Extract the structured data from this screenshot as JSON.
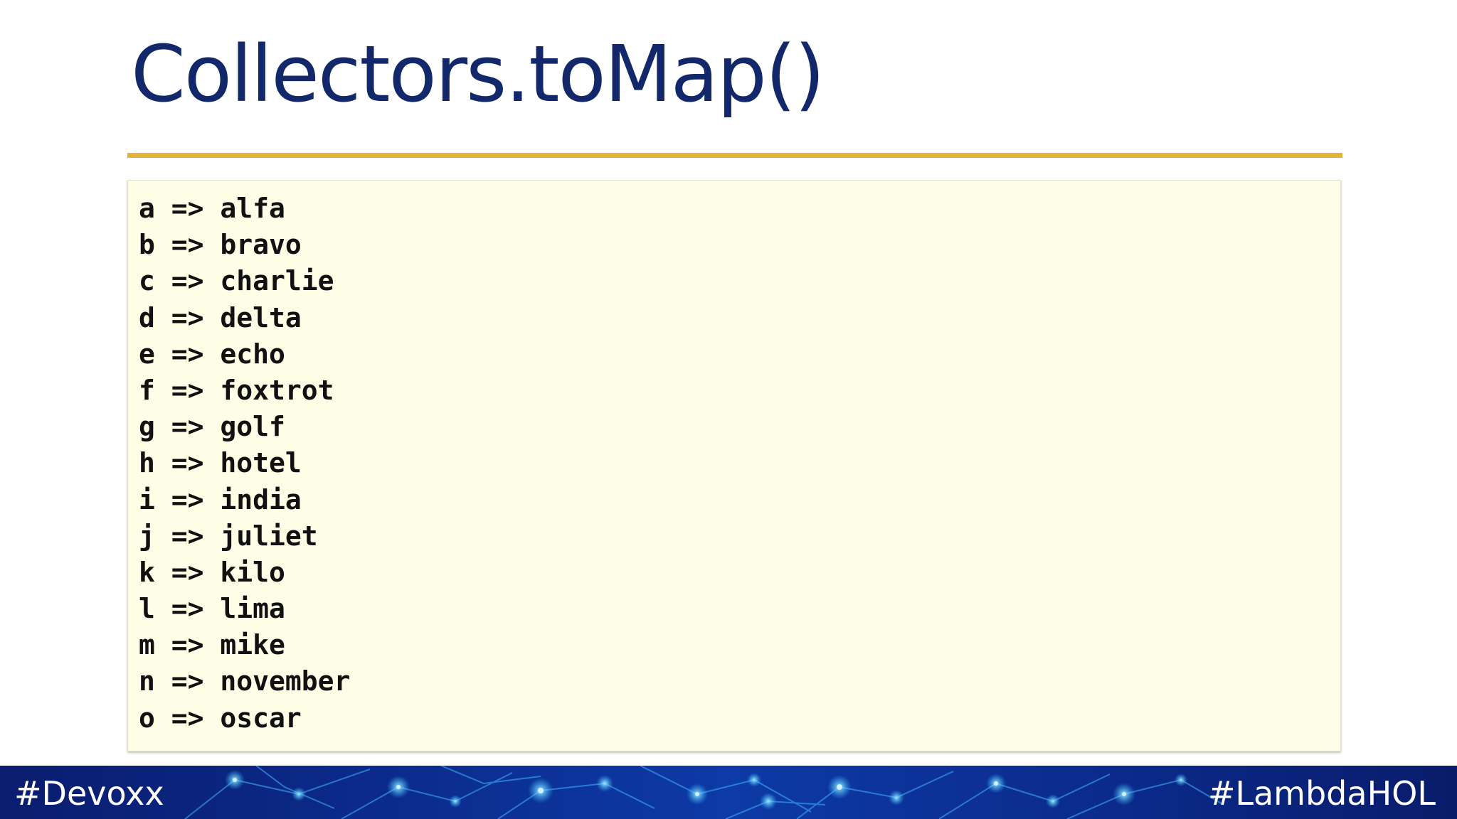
{
  "slide": {
    "title": "Collectors.toMap()",
    "code_lines": [
      "a => alfa",
      "b => bravo",
      "c => charlie",
      "d => delta",
      "e => echo",
      "f => foxtrot",
      "g => golf",
      "h => hotel",
      "i => india",
      "j => juliet",
      "k => kilo",
      "l => lima",
      "m => mike",
      "n => november",
      "o => oscar"
    ]
  },
  "footer": {
    "left_tag": "#Devoxx",
    "right_tag": "#LambdaHOL"
  },
  "colors": {
    "title": "#12286b",
    "accent_rule": "#e7b23a",
    "code_background": "#fefee6",
    "footer_background": "#0b2a8a"
  }
}
